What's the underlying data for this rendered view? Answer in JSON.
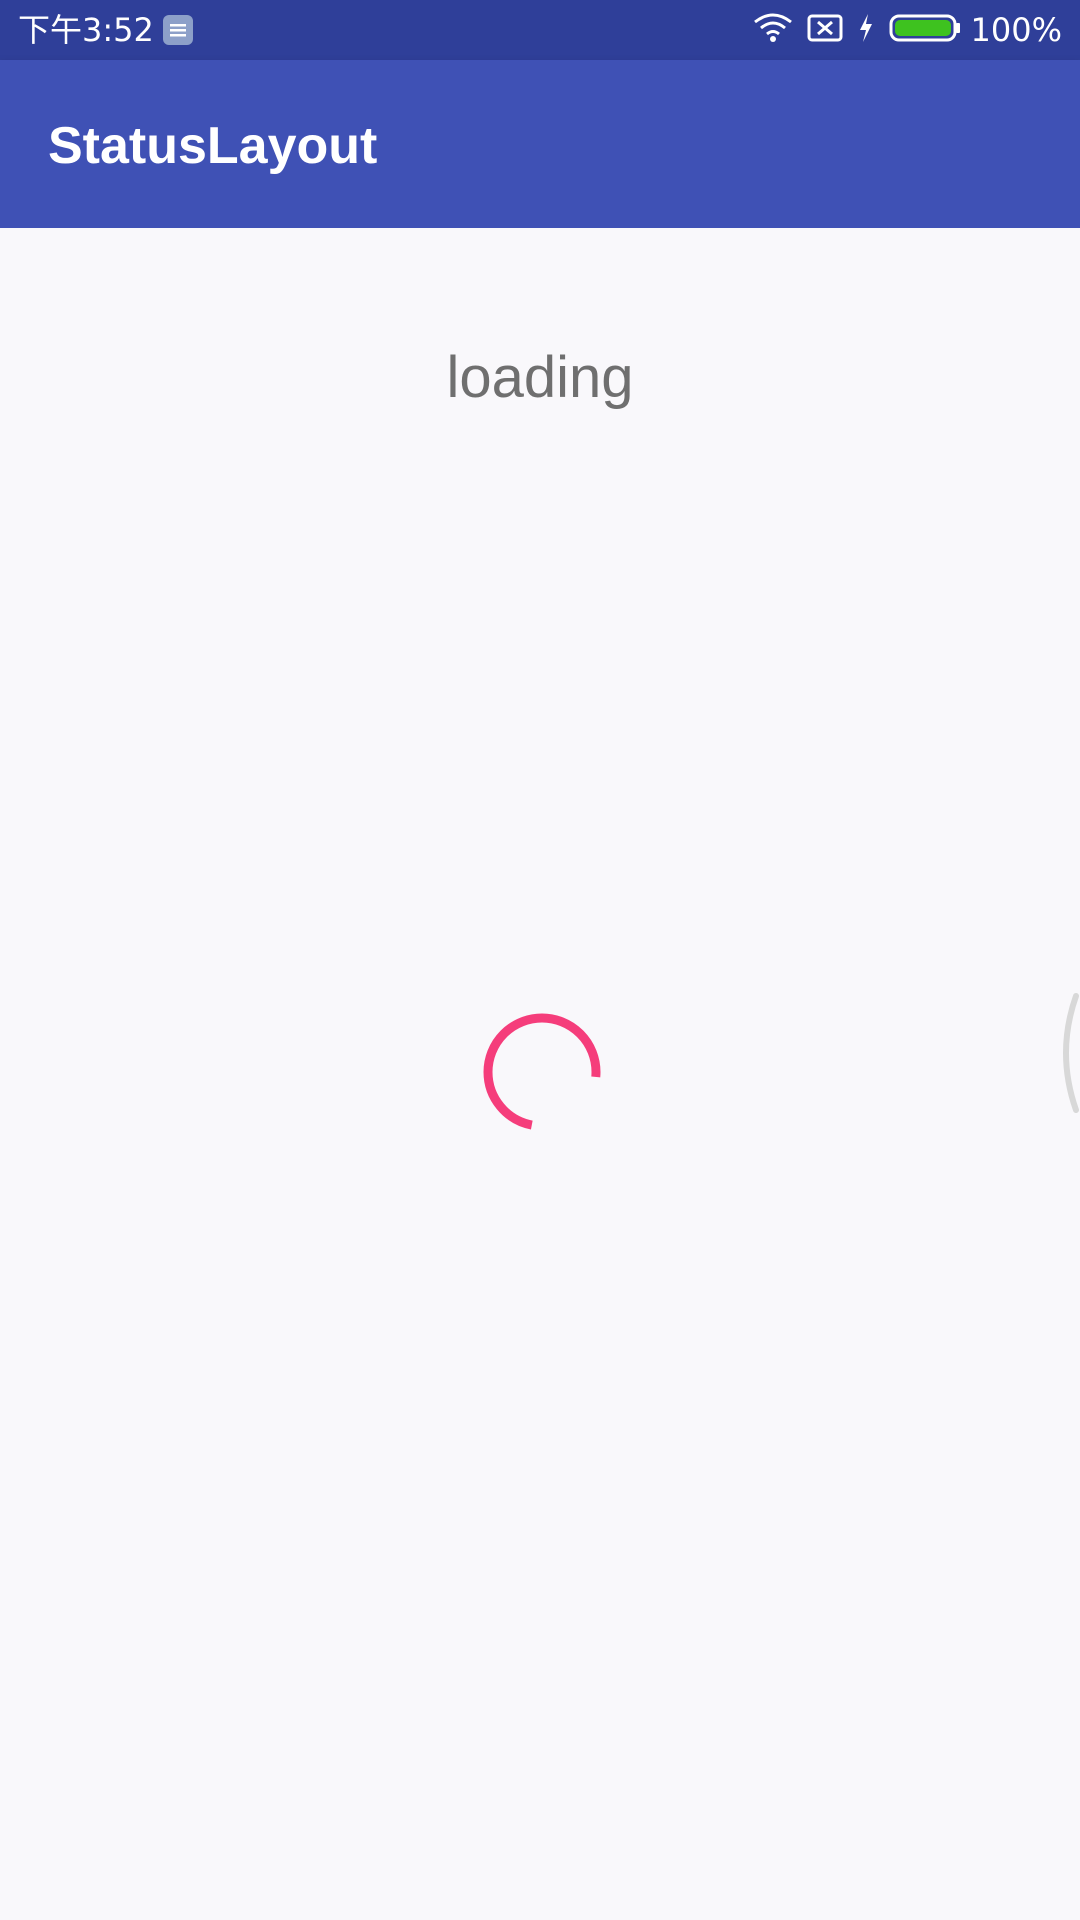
{
  "status_bar": {
    "time": "下午3:52",
    "battery_percent": "100%",
    "icons": [
      "notification-icon",
      "wifi-icon",
      "no-sim-icon",
      "charging-icon",
      "battery-icon"
    ]
  },
  "app_bar": {
    "title": "StatusLayout"
  },
  "content": {
    "loading_text": "loading",
    "spinner_color": "#f53d7b"
  },
  "colors": {
    "status_bar": "#2f3f99",
    "app_bar": "#3f51b5",
    "background": "#f9f8fb",
    "loading_text": "#6f6f6f",
    "accent": "#f53d7b"
  }
}
